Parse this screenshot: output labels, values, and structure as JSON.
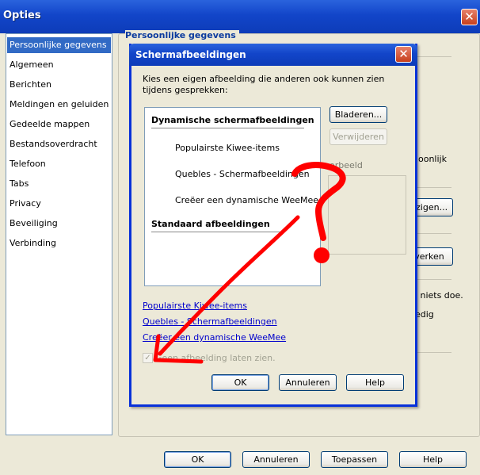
{
  "window": {
    "title": "Opties",
    "close_icon": "close-icon"
  },
  "sidebar": {
    "items": [
      {
        "label": "Persoonlijke gegevens",
        "selected": true
      },
      {
        "label": "Algemeen"
      },
      {
        "label": "Berichten"
      },
      {
        "label": "Meldingen en geluiden"
      },
      {
        "label": "Gedeelde mappen"
      },
      {
        "label": "Bestandsoverdracht"
      },
      {
        "label": "Telefoon"
      },
      {
        "label": "Tabs"
      },
      {
        "label": "Privacy"
      },
      {
        "label": "Beveiliging"
      },
      {
        "label": "Verbinding"
      }
    ]
  },
  "pane": {
    "header": "Persoonlijke gegevens",
    "fragments": {
      "f1": ":",
      "f2": "oonlijk",
      "f3": "n niets doe.",
      "f4": "edig"
    },
    "buttons": {
      "b1": "ijzigen...",
      "b2": "verken"
    }
  },
  "dialog": {
    "title": "Schermafbeeldingen",
    "intro": "Kies een eigen afbeelding die anderen ook kunnen zien tijdens gesprekken:",
    "categories": {
      "dynamic": "Dynamische schermafbeeldingen",
      "standard": "Standaard afbeeldingen"
    },
    "items": [
      "Populairste Kiwee-items",
      "Quebles - Schermafbeeldingen",
      "Creëer een dynamische WeeMee"
    ],
    "browse_button": "Bladeren...",
    "remove_button": "Verwijderen",
    "preview_label": "orbeeld",
    "links": [
      "Populairste Kiwee-items",
      "Quebles - Schermafbeeldingen",
      "Creëer een dynamische WeeMee"
    ],
    "checkbox_label": "Geen afbeelding laten zien.",
    "checkbox_checked": true,
    "ok": "OK",
    "cancel": "Annuleren",
    "help": "Help"
  },
  "footer": {
    "ok": "OK",
    "cancel": "Annuleren",
    "apply": "Toepassen",
    "help": "Help"
  },
  "colors": {
    "titlebar": "#1245c9",
    "selection": "#316ac5",
    "link": "#0000cc",
    "annotation": "#ff0000"
  }
}
